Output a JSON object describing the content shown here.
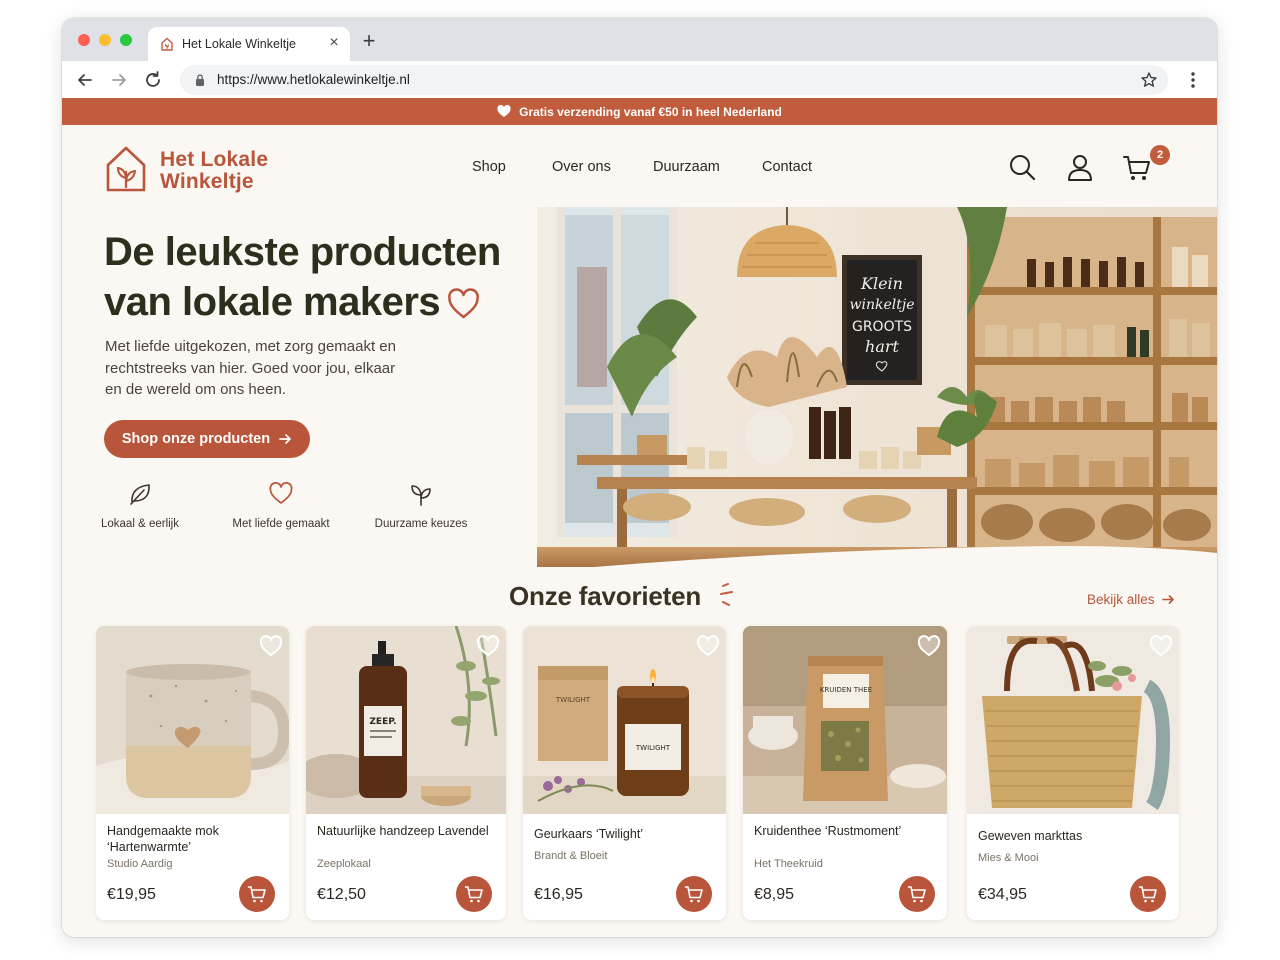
{
  "browser": {
    "tab_title": "Het Lokale Winkeltje",
    "url": "https://www.hetlokalewinkeltje.nl"
  },
  "announcement": {
    "text": "Gratis verzending vanaf €50 in heel Nederland",
    "icon": "heart-icon"
  },
  "brand": {
    "line1": "Het Lokale",
    "line2": "Winkeltje",
    "color": "#b8553a"
  },
  "nav": {
    "items": [
      "Shop",
      "Over ons",
      "Duurzaam",
      "Contact"
    ]
  },
  "header": {
    "cart_count": "2"
  },
  "hero": {
    "title_line1": "De leukste producten",
    "title_line2": "van lokale makers",
    "subtitle": "Met liefde uitgekozen, met zorg gemaakt en rechtstreeks van hier. Goed voor jou, elkaar en de wereld om ons heen.",
    "cta": "Shop onze producten",
    "chalkboard": [
      "Klein",
      "winkeltje",
      "GROOTS",
      "hart"
    ]
  },
  "features": [
    {
      "label": "Lokaal & eerlijk",
      "icon": "leaf-icon"
    },
    {
      "label": "Met liefde gemaakt",
      "icon": "heart-icon"
    },
    {
      "label": "Duurzame keuzes",
      "icon": "sprout-icon"
    }
  ],
  "favorites": {
    "title": "Onze favorieten",
    "see_all": "Bekijk alles",
    "products": [
      {
        "name": "Handgemaakte mok ‘Hartenwarmte’",
        "maker": "Studio Aardig",
        "price": "€19,95"
      },
      {
        "name": "Natuurlijke handzeep Lavendel",
        "maker": "Zeeplokaal",
        "price": "€12,50",
        "label_text": "ZEEP."
      },
      {
        "name": "Geurkaars ‘Twilight’",
        "maker": "Brandt & Bloeit",
        "price": "€16,95",
        "label_text": "TWILIGHT"
      },
      {
        "name": "Kruidenthee ‘Rustmoment’",
        "maker": "Het Theekruid",
        "price": "€8,95",
        "label_text": "KRUIDEN THEE"
      },
      {
        "name": "Geweven markttas",
        "maker": "Mies & Mooi",
        "price": "€34,95"
      }
    ]
  },
  "colors": {
    "accent": "#b8553a",
    "announcement_bg": "#c15c3c",
    "title": "#2c2f1c",
    "page_bg": "#fbf7f2"
  }
}
